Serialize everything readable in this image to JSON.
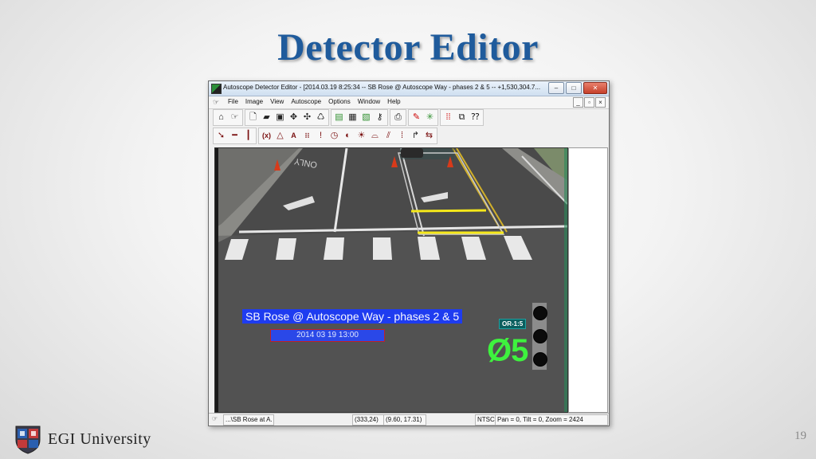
{
  "slide": {
    "title": "Detector Editor",
    "page_number": "19",
    "footer_brand": "EGI University"
  },
  "window": {
    "title": "Autoscope Detector Editor - [2014.03.19  8:25:34 -- SB Rose @ Autoscope Way - phases 2 & 5 -- +1,530,304.7...",
    "buttons": {
      "minimize": "–",
      "maximize": "□",
      "close": "✕"
    },
    "mdi_buttons": {
      "minimize": "_",
      "restore": "▫",
      "close": "×"
    }
  },
  "menu": [
    "File",
    "Image",
    "View",
    "Autoscope",
    "Options",
    "Window",
    "Help"
  ],
  "video": {
    "camera_label": "SB Rose @ Autoscope Way - phases 2 & 5",
    "timestamp": "2014 03 19 13:00",
    "or_badge": "OR-1:5",
    "phase_label": "Ø5",
    "road_text": "ONLY"
  },
  "statusbar": {
    "path": "...\\SB Rose at A.",
    "pixel": "(333,24)",
    "coords": "(9.60, 17.31)",
    "format": "NTSC",
    "ptz": "Pan = 0, Tilt = 0, Zoom = 2424"
  },
  "colors": {
    "title_blue": "#1f5b9c",
    "overlay_blue": "#1e3cf0",
    "phase_green": "#3ef23e",
    "detector_yellow": "#f5e81a"
  },
  "icons": {
    "toolbar1": [
      "home-icon",
      "hand-pointer-icon",
      "new-file-icon",
      "open-folder-icon",
      "save-icon",
      "move-detector-icon",
      "move-detector-alt-icon",
      "recycle-icon",
      "image-load-icon",
      "image-save-icon",
      "image-edit-icon",
      "key-icon",
      "print-icon",
      "detector-edit-icon",
      "grid-icon",
      "red-dots-icon",
      "export-icon",
      "help-icon"
    ],
    "toolbar2": [
      "select-arrow-icon",
      "horizontal-line-icon",
      "vertical-line-icon",
      "presence-detector-icon",
      "count-detector-icon",
      "text-icon",
      "speed-icon",
      "alarm-icon",
      "clock-icon",
      "contrast-icon",
      "brightness-icon",
      "lane-icon",
      "crosswalk-icon",
      "signal-icon",
      "turn-icon",
      "bidirectional-icon"
    ]
  }
}
